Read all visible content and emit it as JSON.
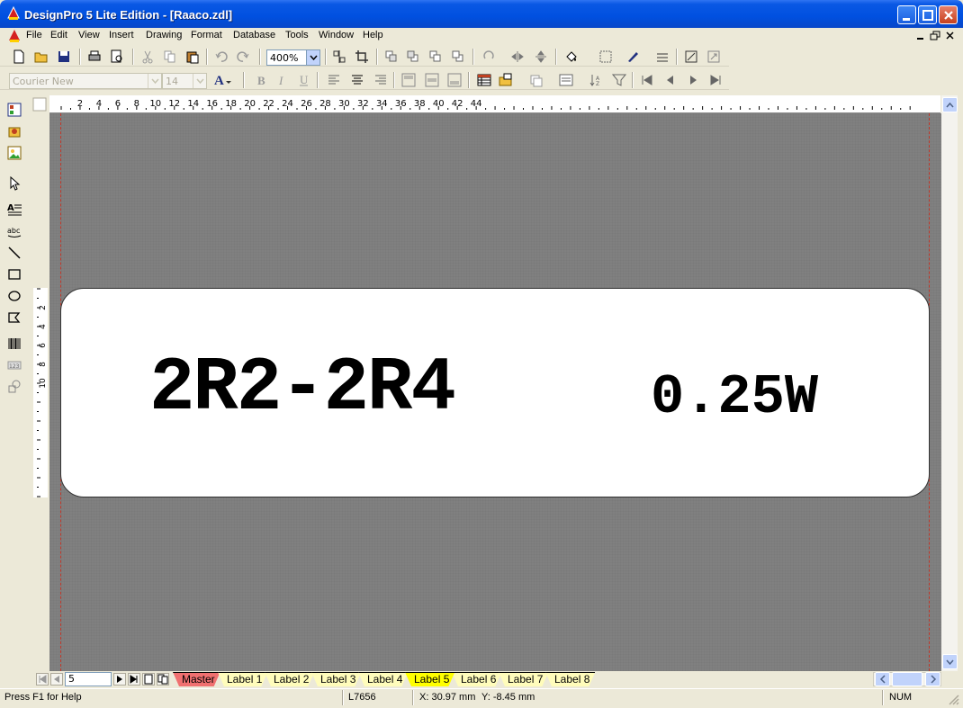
{
  "window": {
    "title": "DesignPro 5 Lite Edition - [Raaco.zdl]",
    "titlebar_color": "#0a58e4"
  },
  "menu": [
    "File",
    "Edit",
    "View",
    "Insert",
    "Drawing",
    "Format",
    "Database",
    "Tools",
    "Window",
    "Help"
  ],
  "toolbar": {
    "zoom_value": "400%",
    "font_name": "Courier New",
    "font_size": "14"
  },
  "ruler": {
    "horizontal": [
      "2",
      "4",
      "6",
      "8",
      "10",
      "12",
      "14",
      "16",
      "18",
      "20",
      "22",
      "24",
      "26",
      "28",
      "30",
      "32",
      "34",
      "36",
      "38",
      "40",
      "42",
      "44"
    ],
    "vertical": [
      "2",
      "4",
      "6",
      "8",
      "10"
    ]
  },
  "label": {
    "part_number": "2R2-2R4",
    "power": "0.25W"
  },
  "pagenav": {
    "current_page": "5"
  },
  "tabs": [
    {
      "label": "Master",
      "color": "#f07070",
      "active": false
    },
    {
      "label": "Label 1",
      "color": "#fffcbb",
      "active": false
    },
    {
      "label": "Label 2",
      "color": "#fffcbb",
      "active": false
    },
    {
      "label": "Label 3",
      "color": "#fffcbb",
      "active": false
    },
    {
      "label": "Label 4",
      "color": "#fffcbb",
      "active": false
    },
    {
      "label": "Label 5",
      "color": "#ffff00",
      "active": true
    },
    {
      "label": "Label 6",
      "color": "#fffcbb",
      "active": false
    },
    {
      "label": "Label 7",
      "color": "#fffcbb",
      "active": false
    },
    {
      "label": "Label 8",
      "color": "#fffcbb",
      "active": false
    }
  ],
  "status": {
    "help": "Press F1 for Help",
    "template": "L7656",
    "x": "X: 30.97 mm",
    "y": "Y: -8.45 mm",
    "num": "NUM"
  }
}
